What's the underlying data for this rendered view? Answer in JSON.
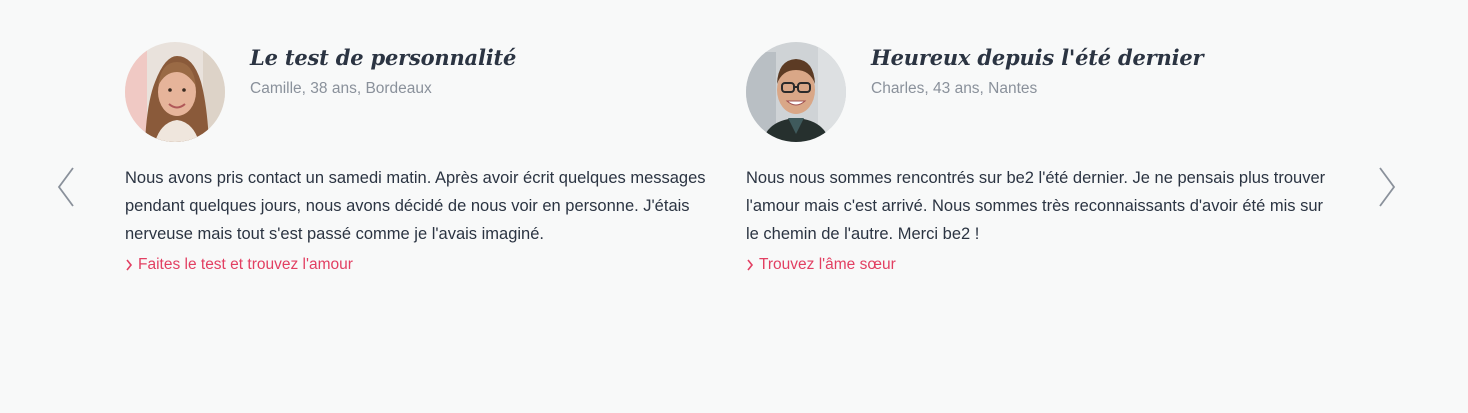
{
  "carousel": {
    "prev_icon": "chevron-left-icon",
    "next_icon": "chevron-right-icon",
    "arrow_color": "#8a919b",
    "testimonials": [
      {
        "title": "Le test de personnalité",
        "meta": "Camille, 38 ans, Bordeaux",
        "text": "Nous avons pris contact un samedi matin. Après avoir écrit quelques messages pendant quelques jours, nous avons décidé de nous voir en personne. J'étais nerveuse mais tout s'est passé comme je l'avais imaginé.",
        "link": "Faites le test et trouvez l'amour",
        "avatar": "woman-portrait-photo"
      },
      {
        "title": "Heureux depuis l'été dernier",
        "meta": "Charles, 43 ans, Nantes",
        "text": "Nous nous sommes rencontrés sur be2 l'été dernier. Je ne pensais plus trouver l'amour mais c'est arrivé. Nous sommes très reconnaissants d'avoir été mis sur le chemin de l'autre. Merci be2 !",
        "link": "Trouvez l'âme sœur",
        "avatar": "man-portrait-photo"
      }
    ],
    "link_color": "#e23f62",
    "text_color": "#2b3442",
    "meta_color": "#8a919b"
  }
}
